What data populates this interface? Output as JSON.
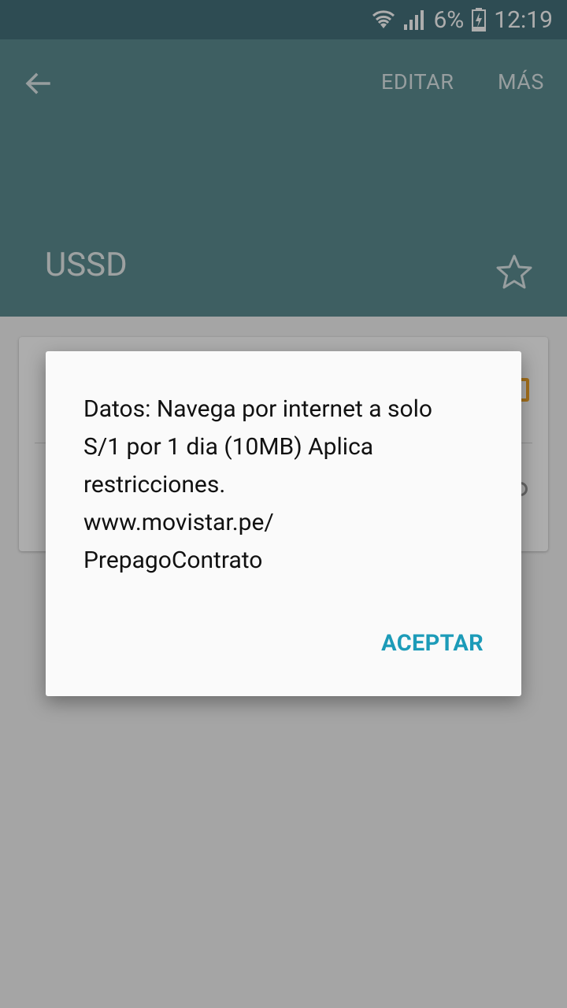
{
  "status_bar": {
    "battery": "6%",
    "time": "12:19",
    "icons": [
      "wifi-icon",
      "signal-icon",
      "battery-charging-icon"
    ]
  },
  "app_bar": {
    "back_icon": "back-arrow-icon",
    "edit_label": "EDITAR",
    "more_label": "MÁS",
    "title": "USSD",
    "favorite_icon": "star-outline-icon"
  },
  "dialog": {
    "message": "Datos: Navega por internet a solo\nS/1 por 1 dia (10MB) Aplica\nrestricciones.\nwww.movistar.pe/\nPrepagoContrato",
    "accept_label": "ACEPTAR"
  },
  "colors": {
    "status_bar": "#45717b",
    "app_bar": "#5c8c91",
    "accent": "#1c9bb8",
    "card_icon": "#f3a72a"
  }
}
